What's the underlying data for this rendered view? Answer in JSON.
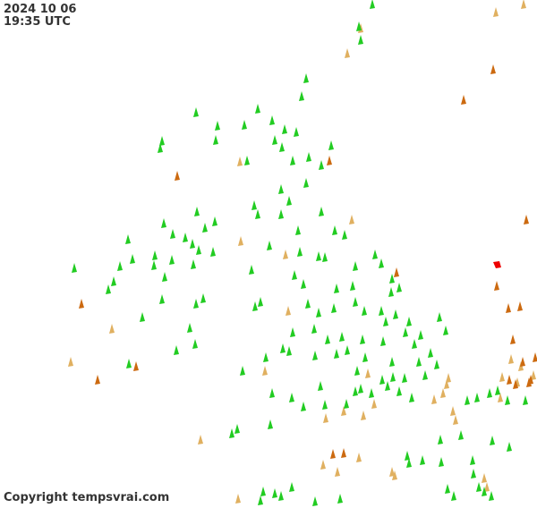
{
  "timestamp": {
    "date": "2024 10 06",
    "time": "19:35 UTC"
  },
  "copyright": "Copyright tempsvrai.com",
  "legend_colors": {
    "recent": "#22cc22",
    "older": "#e0b060",
    "oldest": "#cc6a10",
    "latest": "#ee0000"
  }
}
